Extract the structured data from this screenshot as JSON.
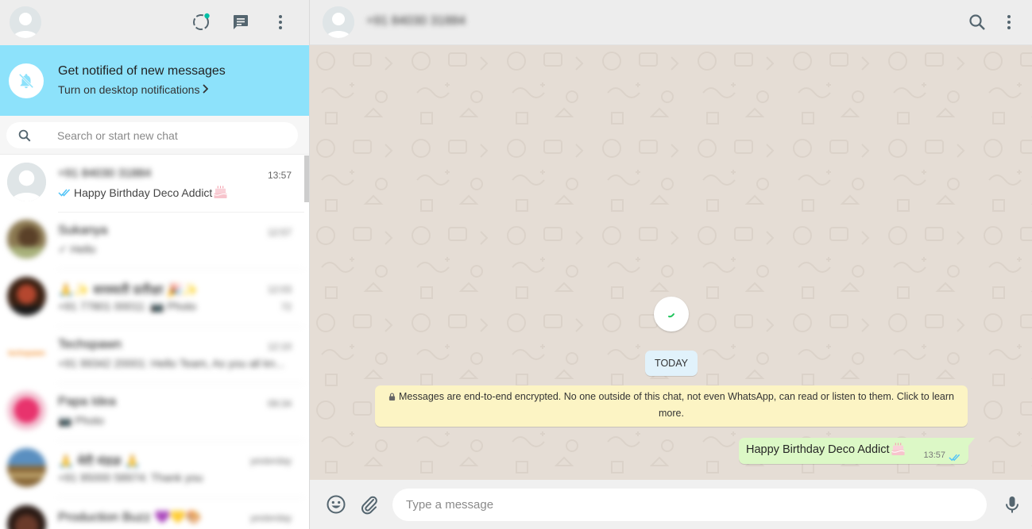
{
  "left_header": {
    "icons": [
      "default-avatar-icon",
      "status-icon",
      "new-chat-icon",
      "menu-icon"
    ],
    "status_dot_color": "#00bfa5"
  },
  "notification": {
    "title": "Get notified of new messages",
    "link": "Turn on desktop notifications",
    "background": "#8de2fb"
  },
  "search": {
    "placeholder": "Search or start new chat"
  },
  "chats": [
    {
      "name": "+91 84030 31884",
      "time": "13:57",
      "preview": "Happy Birthday Deco Addict",
      "ticks": "read",
      "emoji": "birthday-cake",
      "active": true,
      "blurred_name": true
    },
    {
      "name": "Sukanya",
      "time": "12:57",
      "preview": "✓ Hello",
      "blurred": true
    },
    {
      "name": "🙏✨ सरस्वती प्रतीक्षा 🎉✨",
      "time": "12:03",
      "preview": "+91 77801 00011: 📷 Photo",
      "badge": "72",
      "blurred": true
    },
    {
      "name": "Techspawn",
      "time": "12:10",
      "preview": "+91 99342 20001: Hello Team, As you all kn...",
      "blurred": true,
      "logo_text": "techspawn"
    },
    {
      "name": "Papa Idea",
      "time": "09:34",
      "preview": "📷 Photo",
      "blurred": true
    },
    {
      "name": "🙏 मेरी मंडळ 🙏",
      "time": "yesterday",
      "preview": "+91 95000 58974: Thank you",
      "blurred": true
    },
    {
      "name": "Production Buzz 💜💛🎨",
      "time": "yesterday",
      "preview": "",
      "blurred": true
    }
  ],
  "contact": {
    "name": "+91 84030 31884"
  },
  "right_header": {
    "icons": [
      "search-icon",
      "menu-icon"
    ]
  },
  "conversation": {
    "date_chip": "TODAY",
    "encryption_note": "Messages are end-to-end encrypted. No one outside of this chat, not even WhatsApp, can read or listen to them. Click to learn more.",
    "messages": [
      {
        "direction": "out",
        "text": "Happy Birthday Deco Addict",
        "emoji": "birthday-cake",
        "time": "13:57",
        "ticks": "read"
      }
    ],
    "background": "#e5ddd5",
    "outgoing_bubble": "#dcf8c6",
    "tick_color": "#4fc3f7"
  },
  "composer": {
    "placeholder": "Type a message",
    "icons": [
      "emoji-icon",
      "attach-icon",
      "microphone-icon"
    ]
  }
}
